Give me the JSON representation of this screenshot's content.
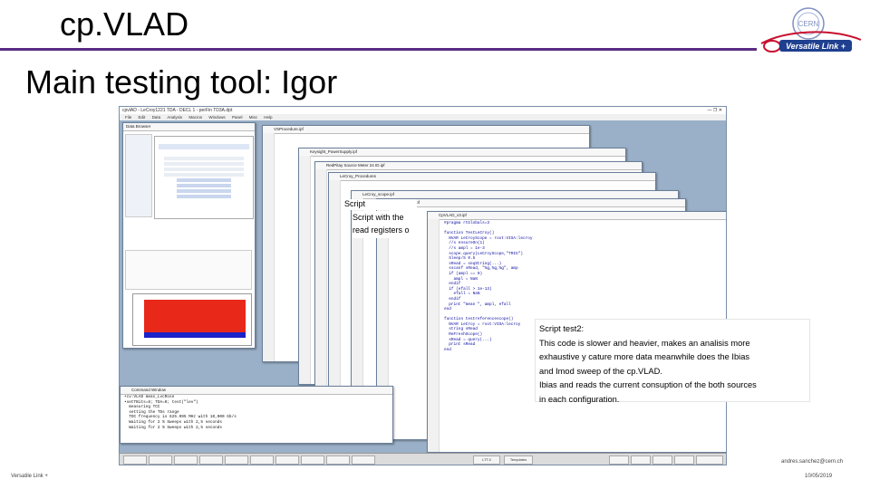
{
  "slide": {
    "title": "cp.VLAD",
    "subtitle": "Main testing tool: Igor",
    "logo_text": "Versatile Link +",
    "logo_mark": "CERN",
    "footer_left": "Versatile Link +",
    "footer_email": "andres.sanchez@cern.ch",
    "footer_date": "10/05/2019",
    "colors": {
      "rule": "#5a2a82",
      "logo_blue": "#1f3f8f",
      "logo_red": "#c8102e"
    }
  },
  "igor": {
    "window_title": "cpvlAD - LeCroy1221 TDA - DECL 1 - perFin TD3A.dpt",
    "menu": [
      "File",
      "Edit",
      "Data",
      "Analysis",
      "Macros",
      "Windows",
      "Panel",
      "Misc",
      "Help"
    ],
    "data_browser_title": "Data Browser",
    "windows": [
      "VSProcedure.ipf",
      "Keysight_PowerSupply.ipf",
      "RedPitay Source Meter 24 ID.ipf",
      "LeCroy_Procedures",
      "LeCroy_scope.ipf",
      "LD3Procedure.ipf",
      "CpVLAD_v3.ipf"
    ],
    "command_title": "Command Window",
    "code_lines": [
      "#pragma rtGlobals=3",
      "",
      "function TestLeCroy()",
      "  NVAR LeCroyScope = root:VISA:lecroy",
      "  //s ensureOn(1)",
      "  //s ampl = 1e-3",
      "  scope.query(LeCroyScope,\"TRIG\")",
      "  Sleep/S 0.5",
      "  sRead = seqString(...)",
      "  sscanf sRead, \"%g,%g,%g\", amp",
      "  if (ampl == 0)",
      "    ampl = NaN",
      "  endif",
      "  if (efall > 1e-13)",
      "    efall = NaN",
      "  endif",
      "  print \"mean \", ampl, efall",
      "end",
      "",
      "function testreferencescope()",
      "  NVAR LeCroy = root:VISA:lecroy",
      "  string sRead",
      "  ReFreshScope()",
      "  sRead = query(...)",
      "  print sRead",
      "end"
    ],
    "command_lines": [
      "•cv:VLAD meas_LvcRose",
      "•setTBits=8; TDA=0; test(\"lev\")",
      "  measuring TCC",
      "  setting the TDs range",
      "  TDC frequency is 625.995 MHz with 10,000 Gb/s",
      "  Waiting for 2 % Sweeps with 2,5 seconds",
      "  Waiting for 2 % Sweeps with 2,5 seconds"
    ],
    "taskbar_items": [
      "LTT.0",
      "Templates"
    ]
  },
  "callouts": {
    "script1_line1": "Script with the",
    "script1_line2": "read registers o",
    "script1_head": "Script",
    "script2_title": "Script test2:",
    "script2_body": [
      "This code is slower and heavier, makes an analisis more",
      "exhaustive y cature more data meanwhile does the Ibias",
      "and Imod sweep of the cp.VLAD.",
      "Ibias and reads the current consuption of the both sources",
      "in each configuration."
    ]
  }
}
